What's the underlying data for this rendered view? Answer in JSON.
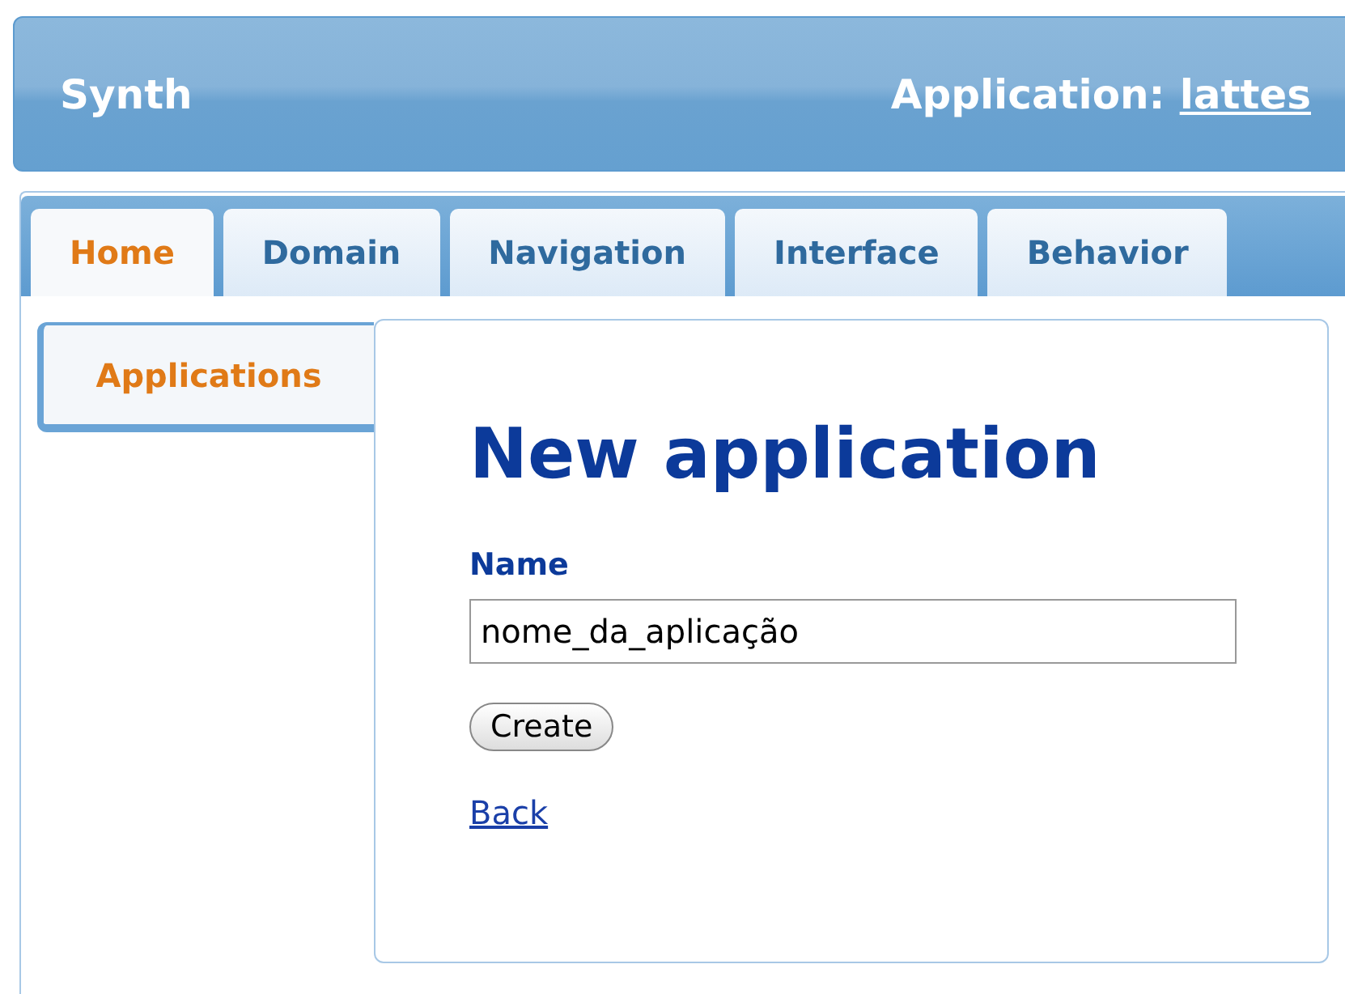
{
  "header": {
    "title": "Synth",
    "application_label": "Application:",
    "application_link": "lattes"
  },
  "tabs": [
    {
      "label": "Home",
      "selected": true
    },
    {
      "label": "Domain",
      "selected": false
    },
    {
      "label": "Navigation",
      "selected": false
    },
    {
      "label": "Interface",
      "selected": false
    },
    {
      "label": "Behavior",
      "selected": false
    }
  ],
  "sidebar": {
    "items": [
      {
        "label": "Applications",
        "selected": true
      }
    ]
  },
  "form": {
    "heading": "New application",
    "field_label": "Name",
    "field_value": "nome_da_aplicação",
    "submit": "Create",
    "back_link": "Back"
  }
}
